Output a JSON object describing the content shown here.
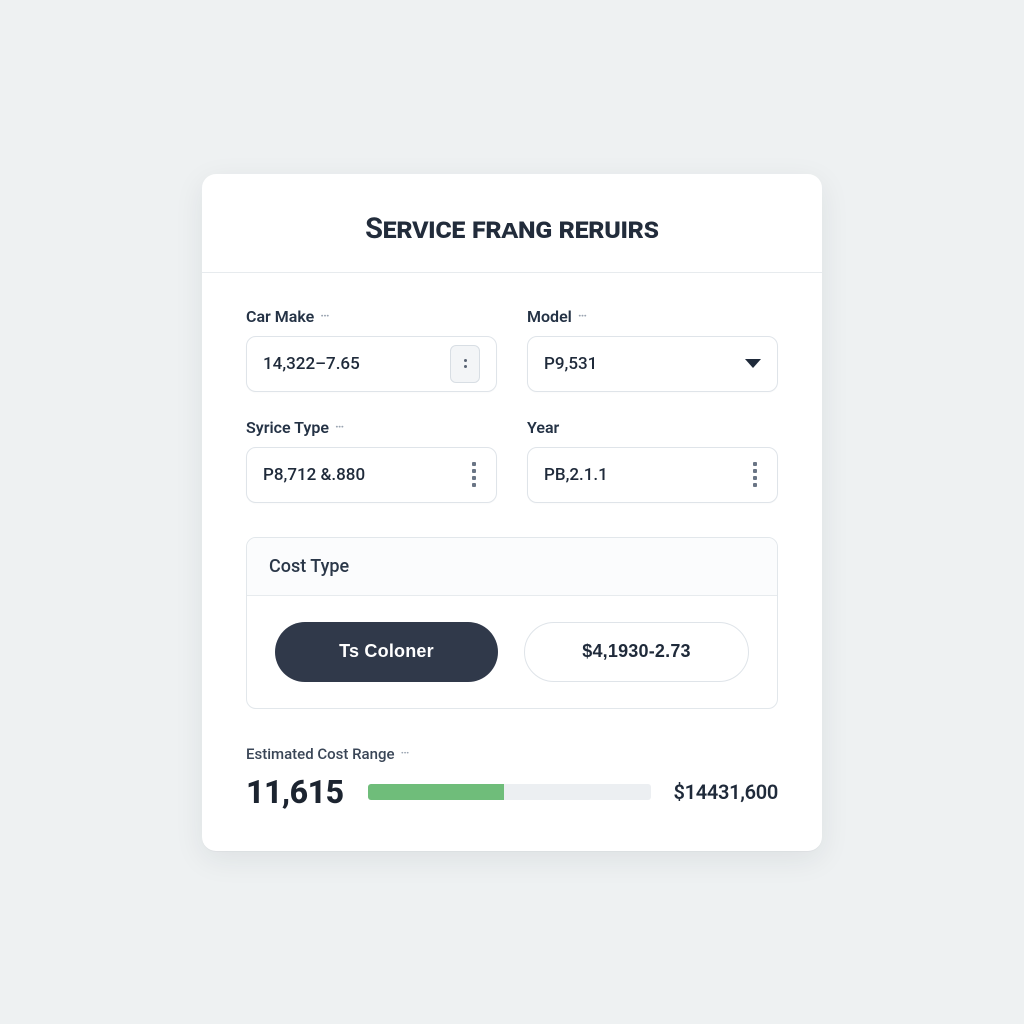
{
  "header": {
    "title": "Service frᴀng reruirs"
  },
  "fields": {
    "carMake": {
      "label": "Car Make",
      "value": "14,322–7.65"
    },
    "model": {
      "label": "Model",
      "value": "P9,531"
    },
    "syriceType": {
      "label": "Syrice Type",
      "value": "P8,712 &.880"
    },
    "year": {
      "label": "Year",
      "value": "PB,2.1.1"
    }
  },
  "costType": {
    "label": "Cost Type",
    "options": {
      "primary": "Ts Coloner",
      "secondary": "$4,1930-2.73"
    }
  },
  "estimate": {
    "label": "Estimated Cost Range",
    "low": "11,615",
    "high": "$14431,600",
    "progressPct": "48%"
  }
}
